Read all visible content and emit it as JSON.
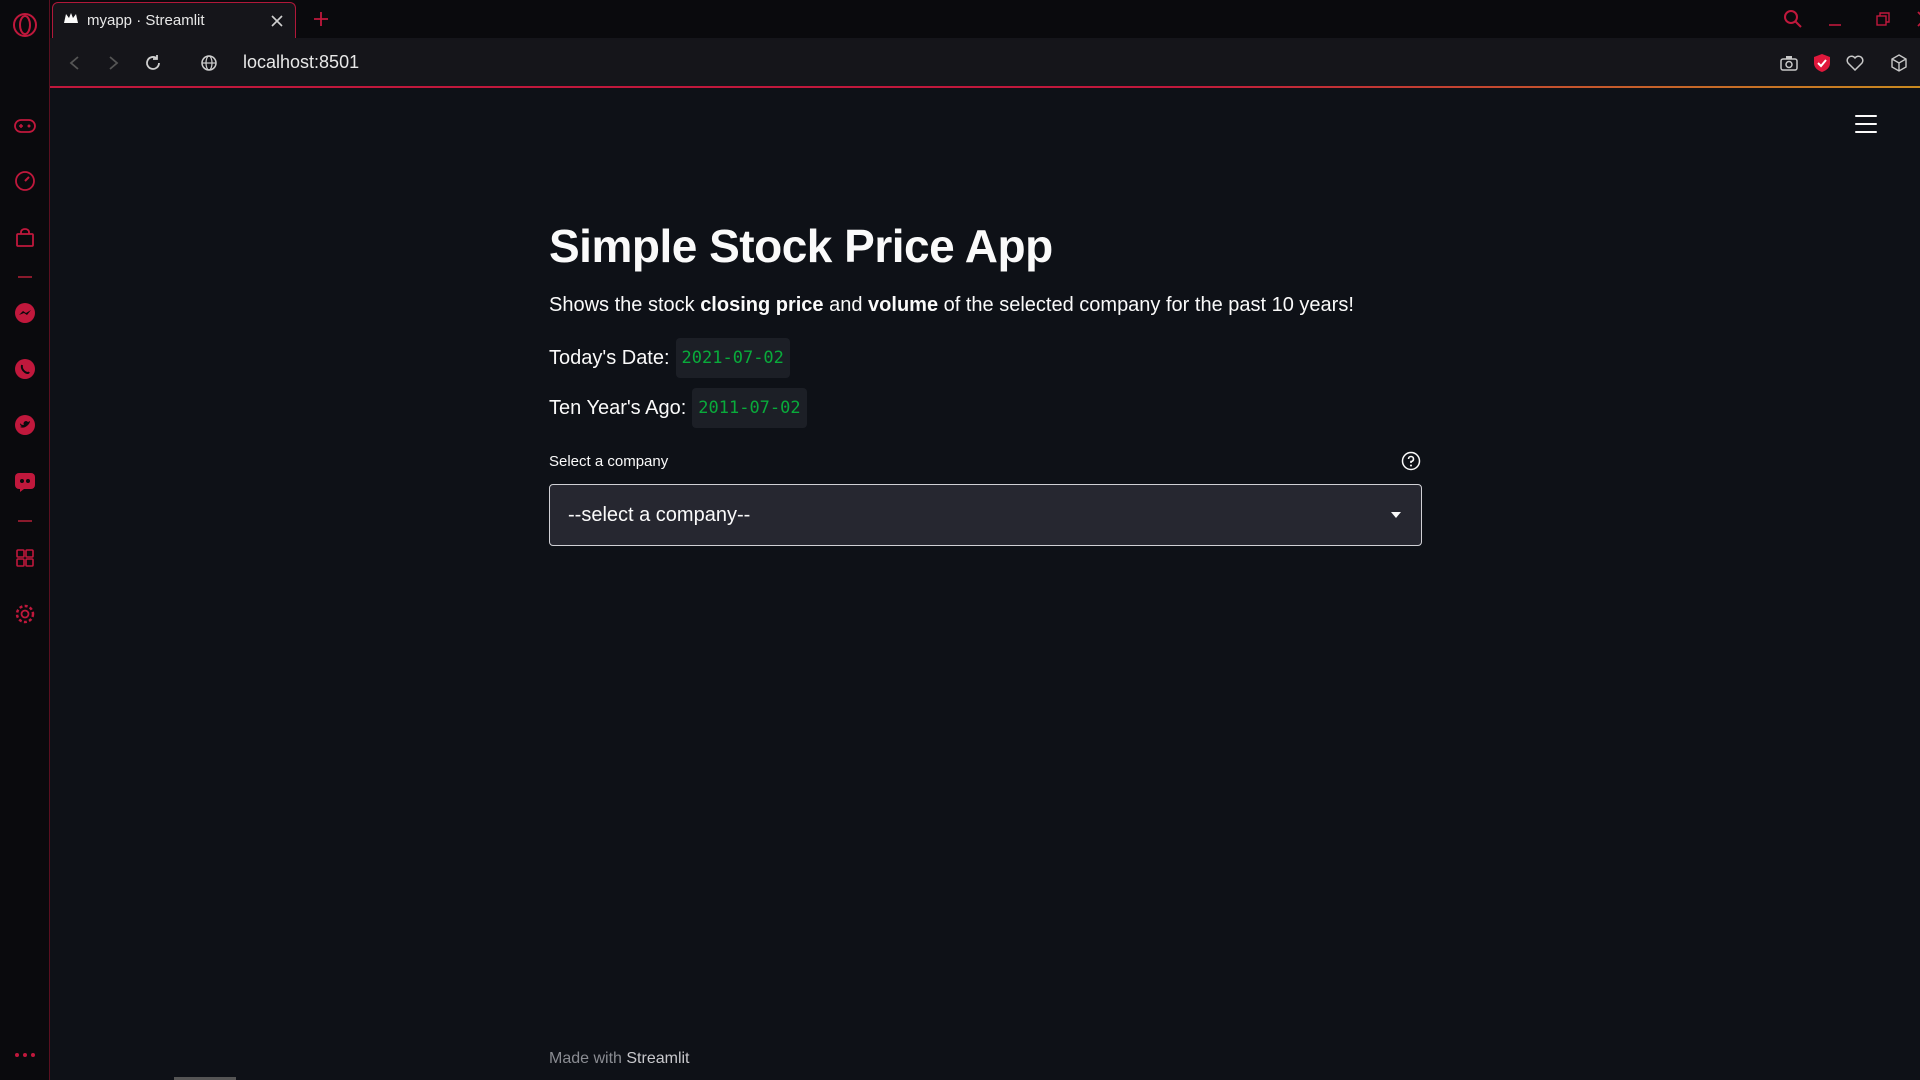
{
  "browser": {
    "tab_title": "myapp · Streamlit",
    "url": "localhost:8501"
  },
  "app": {
    "title": "Simple Stock Price App",
    "description": {
      "prefix": "Shows the stock ",
      "bold1": "closing price",
      "middle": " and ",
      "bold2": "volume",
      "suffix": " of the selected company for the past 10 years!"
    },
    "today_label": "Today's Date:",
    "today_value": "2021-07-02",
    "ago_label": "Ten Year's Ago:",
    "ago_value": "2011-07-02",
    "select": {
      "label": "Select a company",
      "value": "--select a company--"
    },
    "footer": {
      "prefix": "Made with ",
      "link": "Streamlit"
    }
  },
  "colors": {
    "accent": "#c0183c",
    "code_green": "#09ab3b",
    "background": "#0e1117"
  }
}
